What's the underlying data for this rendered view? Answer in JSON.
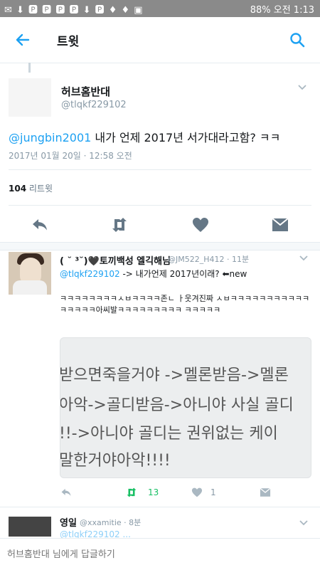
{
  "status_bar": {
    "left": "✉ ⬇ 🅿 🅿 🅿 🅿 ⬇ 🅿 ♦ ♦ ▣",
    "right": "88% 오전 1:13"
  },
  "header": {
    "title": "트윗"
  },
  "main_tweet": {
    "name": "허브홈반대",
    "handle": "@tlqkf229102",
    "mention": "@jungbin2001",
    "text": " 내가 언제 2017년 서가대라고함? ㅋㅋ",
    "timestamp": "2017년 01월 20일 · 12:58 오전",
    "retweet_count": "104",
    "retweet_label": "리트윗"
  },
  "reply": {
    "name": "( ˘ ³˘)🖤토끼백성 엘긱해님",
    "meta": "@JM522_H412 · 11분",
    "reply_to": "@tlqkf229102",
    "reply_suffix": " -> 내가언제 2017년이래? ⬅new",
    "body": "ㅋㅋㅋㅋㅋㅋㅋㅋㅅㅂㅋㅋㅋㅋ존ㄴ ㅏ웃겨진짜 ㅅㅂㅋㅋㅋㅋㅋㅋㅋㅋㅋㅋㅋㅋㅋㅋㅋㅋ아씨발ㅋㅋㅋㅋㅋㅋㅋㅋㅋ ㅋㅋㅋㅋㅋ",
    "quote_lines": [
      "받으면죽을거야 ->멜론받음->멜론",
      "아악->골디받음->아니야 사실 골디",
      "!!->아니야 골디는 권위없는 케이",
      "말한거야아악!!!!"
    ],
    "retweets": "13",
    "likes": "1"
  },
  "next_reply": {
    "name": "영일",
    "meta": "@xxamitie · 8분",
    "preview": "@tlqkf229102 ..."
  },
  "composer": {
    "placeholder": "허브홈반대 님에게 답글하기"
  },
  "colors": {
    "accent": "#1da1f2",
    "retweet_green": "#17bf63",
    "icon_gray": "#657786"
  }
}
